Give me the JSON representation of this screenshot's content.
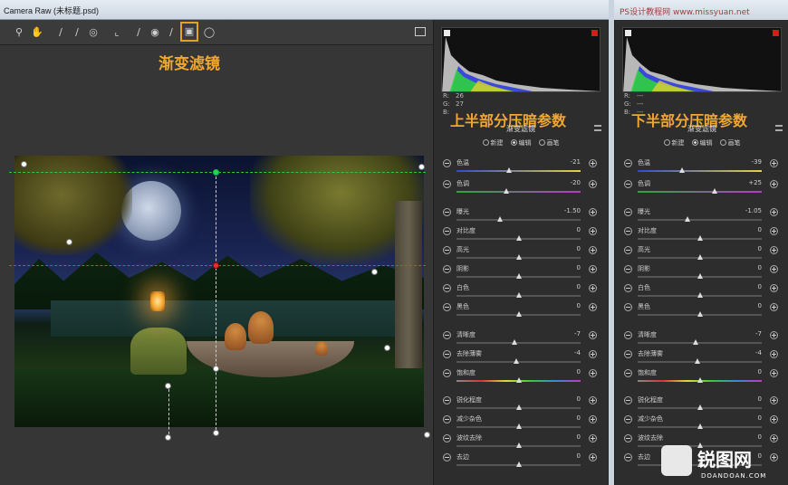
{
  "window": {
    "title": "Camera Raw (未标题.psd)"
  },
  "toolbar": {
    "tools": [
      "zoom-tool",
      "hand-tool",
      "white-balance-tool",
      "color-sampler-tool",
      "targeted-adjustment-tool",
      "crop-tool",
      "straighten-tool",
      "red-eye-tool",
      "adjustment-brush-tool",
      "graduated-filter-tool",
      "radial-filter-tool",
      "open-preferences-tool"
    ],
    "selected_tool": "graduated-filter-tool"
  },
  "annotations": {
    "tool_label": "渐变滤镜",
    "panel1_label": "上半部分压暗参数",
    "panel2_label": "下半部分压暗参数"
  },
  "watermark_top": "PS设计教程网 www.missyuan.net",
  "logo": {
    "name": "锐图网",
    "site": "DOANDOAN.COM"
  },
  "panel1": {
    "readout": {
      "r_label": "R:",
      "r": "26",
      "g_label": "G:",
      "g": "27",
      "b_label": "B:",
      "b": ""
    },
    "title": "渐变滤镜",
    "modes": [
      "新建",
      "编辑",
      "画笔"
    ],
    "selected_mode": "编辑",
    "sliders": [
      {
        "label": "色温",
        "value": "-21",
        "pos": 0.42,
        "track": "temp"
      },
      {
        "label": "色调",
        "value": "-20",
        "pos": 0.4,
        "track": "tint"
      },
      {
        "label": "曝光",
        "value": "-1.50",
        "pos": 0.35,
        "track": "plain"
      },
      {
        "label": "对比度",
        "value": "0",
        "pos": 0.5,
        "track": "plain"
      },
      {
        "label": "高光",
        "value": "0",
        "pos": 0.5,
        "track": "plain"
      },
      {
        "label": "阴影",
        "value": "0",
        "pos": 0.5,
        "track": "plain"
      },
      {
        "label": "白色",
        "value": "0",
        "pos": 0.5,
        "track": "plain"
      },
      {
        "label": "黑色",
        "value": "0",
        "pos": 0.5,
        "track": "plain"
      },
      {
        "label": "清晰度",
        "value": "-7",
        "pos": 0.47,
        "track": "plain"
      },
      {
        "label": "去除薄雾",
        "value": "-4",
        "pos": 0.48,
        "track": "plain"
      },
      {
        "label": "饱和度",
        "value": "0",
        "pos": 0.5,
        "track": "sat"
      },
      {
        "label": "锐化程度",
        "value": "0",
        "pos": 0.5,
        "track": "plain"
      },
      {
        "label": "减少杂色",
        "value": "0",
        "pos": 0.5,
        "track": "plain"
      },
      {
        "label": "波纹去除",
        "value": "0",
        "pos": 0.5,
        "track": "plain"
      },
      {
        "label": "去边",
        "value": "0",
        "pos": 0.5,
        "track": "plain"
      }
    ]
  },
  "panel2": {
    "readout": {
      "r_label": "R:",
      "r": "---",
      "g_label": "G:",
      "g": "---",
      "b_label": "B:",
      "b": "---"
    },
    "title": "渐变滤镜",
    "modes": [
      "新建",
      "编辑",
      "画笔"
    ],
    "selected_mode": "编辑",
    "sliders": [
      {
        "label": "色温",
        "value": "-39",
        "pos": 0.36,
        "track": "temp"
      },
      {
        "label": "色调",
        "value": "+25",
        "pos": 0.62,
        "track": "tint"
      },
      {
        "label": "曝光",
        "value": "-1.05",
        "pos": 0.4,
        "track": "plain"
      },
      {
        "label": "对比度",
        "value": "0",
        "pos": 0.5,
        "track": "plain"
      },
      {
        "label": "高光",
        "value": "0",
        "pos": 0.5,
        "track": "plain"
      },
      {
        "label": "阴影",
        "value": "0",
        "pos": 0.5,
        "track": "plain"
      },
      {
        "label": "白色",
        "value": "0",
        "pos": 0.5,
        "track": "plain"
      },
      {
        "label": "黑色",
        "value": "0",
        "pos": 0.5,
        "track": "plain"
      },
      {
        "label": "清晰度",
        "value": "-7",
        "pos": 0.47,
        "track": "plain"
      },
      {
        "label": "去除薄雾",
        "value": "-4",
        "pos": 0.48,
        "track": "plain"
      },
      {
        "label": "饱和度",
        "value": "0",
        "pos": 0.5,
        "track": "sat"
      },
      {
        "label": "锐化程度",
        "value": "0",
        "pos": 0.5,
        "track": "plain"
      },
      {
        "label": "减少杂色",
        "value": "0",
        "pos": 0.5,
        "track": "plain"
      },
      {
        "label": "波纹去除",
        "value": "0",
        "pos": 0.5,
        "track": "plain"
      },
      {
        "label": "去边",
        "value": "0",
        "pos": 0.5,
        "track": "plain"
      }
    ]
  },
  "colors": {
    "accent": "#f0a830",
    "guide_top": "#34c838",
    "guide_mid": "#e03a3a"
  }
}
